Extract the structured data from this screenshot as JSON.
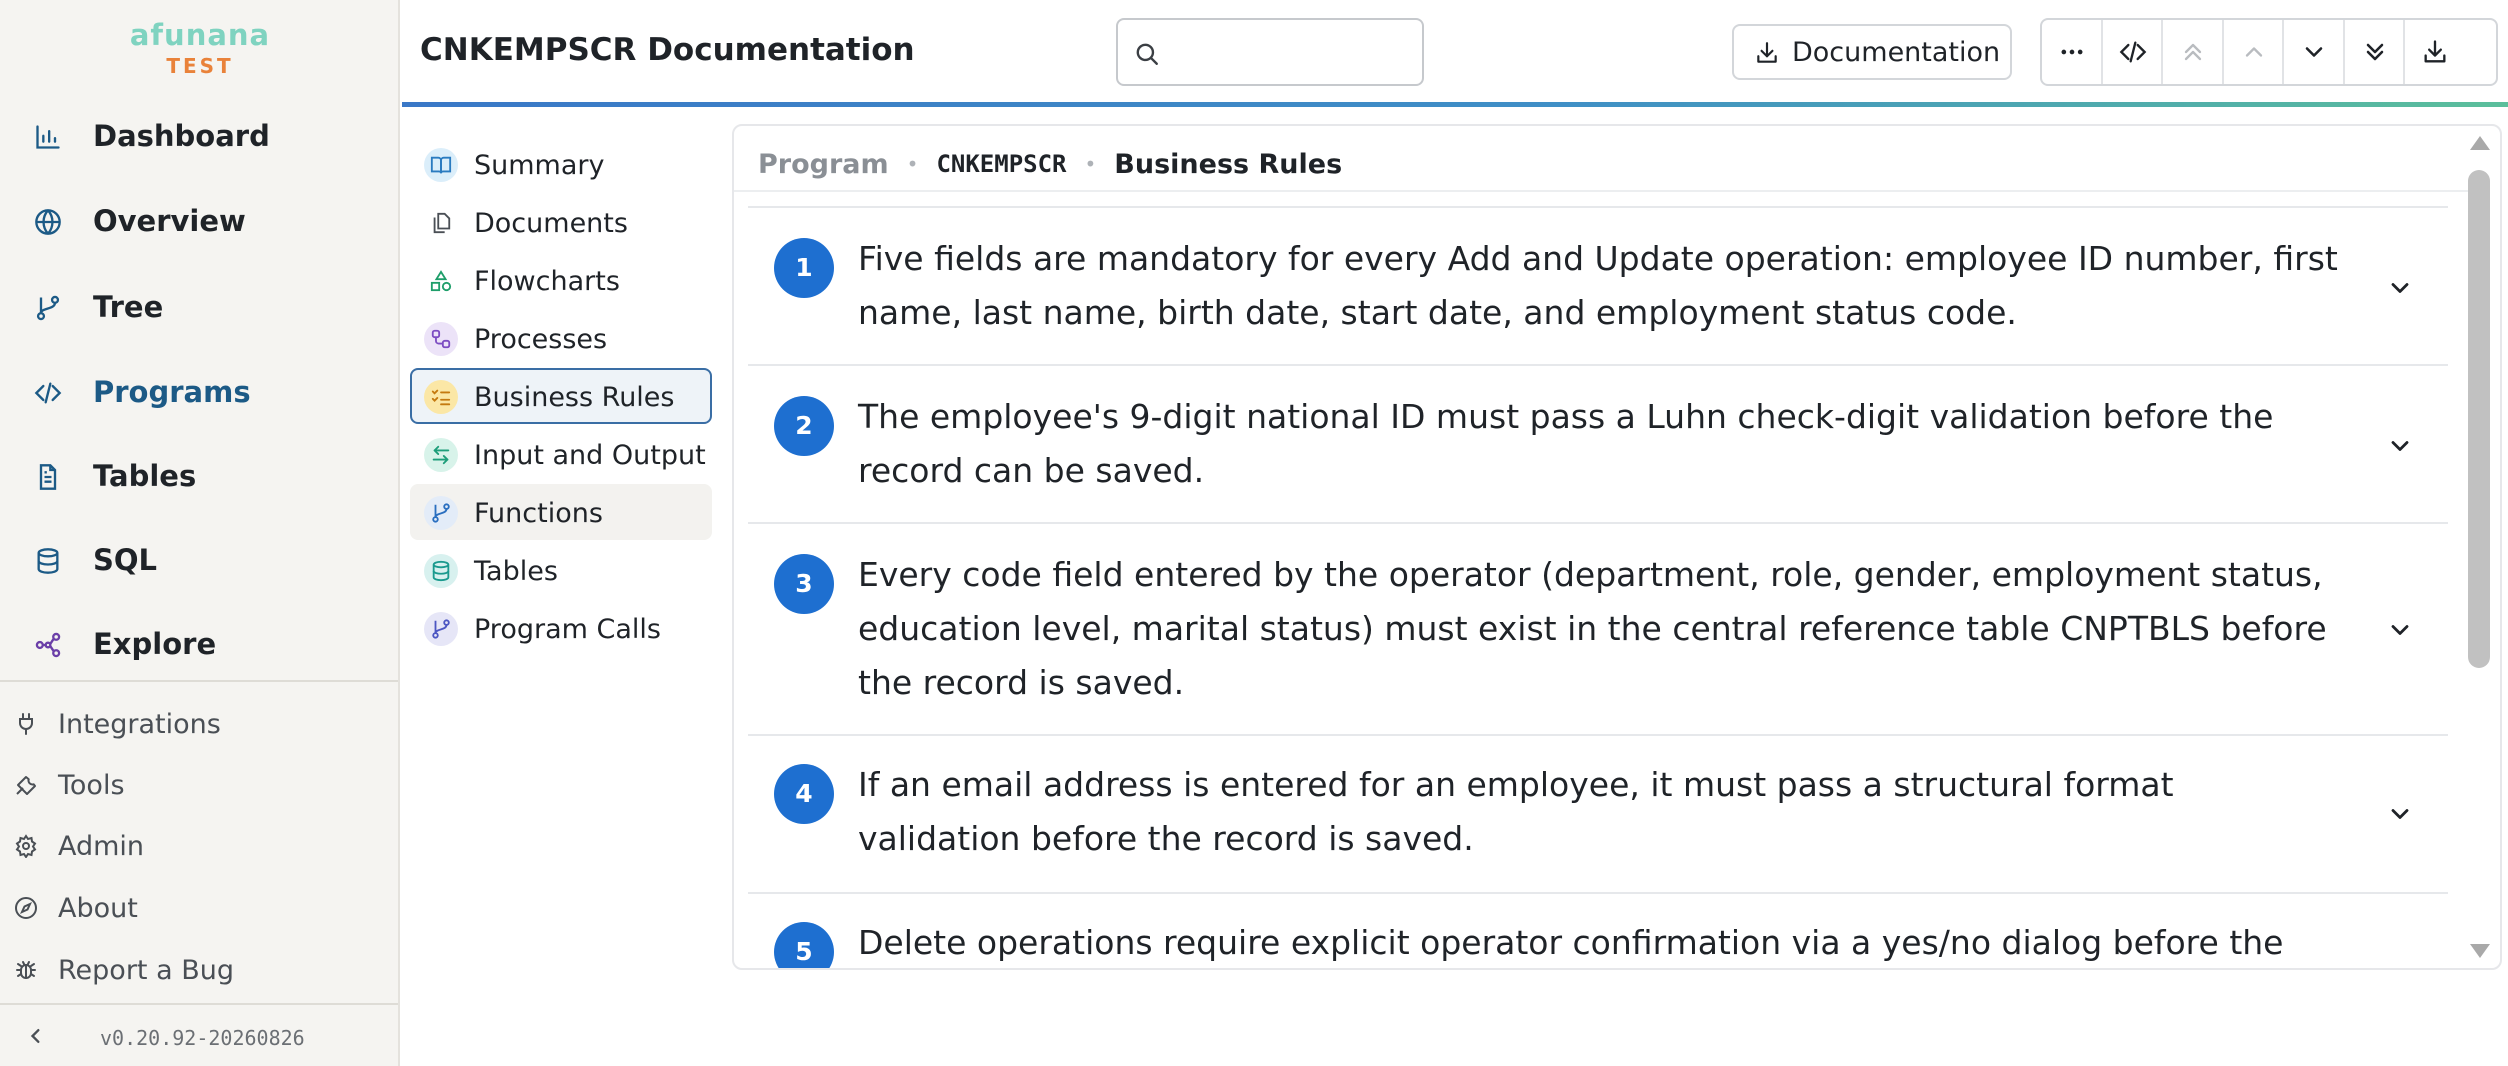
{
  "app": {
    "logo_name": "afunana",
    "logo_env": "TEST",
    "version": "v0.20.92-20260826"
  },
  "sidebar": {
    "items": [
      {
        "label": "Dashboard",
        "icon": "bar-chart-icon"
      },
      {
        "label": "Overview",
        "icon": "globe-icon"
      },
      {
        "label": "Tree",
        "icon": "branch-icon"
      },
      {
        "label": "Programs",
        "icon": "code-icon",
        "active": true
      },
      {
        "label": "Tables",
        "icon": "document-icon"
      },
      {
        "label": "SQL",
        "icon": "database-icon"
      },
      {
        "label": "Explore",
        "icon": "graph-icon"
      }
    ],
    "utilities": [
      {
        "label": "Integrations",
        "icon": "plug-icon"
      },
      {
        "label": "Tools",
        "icon": "wrench-icon"
      },
      {
        "label": "Admin",
        "icon": "gear-icon"
      },
      {
        "label": "About",
        "icon": "compass-icon"
      },
      {
        "label": "Report a Bug",
        "icon": "bug-icon"
      }
    ]
  },
  "header": {
    "title": "CNKEMPSCR Documentation",
    "search_value": "",
    "documentation_button": "Documentation",
    "toolbar": [
      "more-icon",
      "code-icon",
      "double-chevron-up-icon",
      "chevron-up-icon",
      "chevron-down-icon",
      "double-chevron-down-icon",
      "download-icon"
    ]
  },
  "subnav": {
    "items": [
      {
        "label": "Summary",
        "icon": "book-icon"
      },
      {
        "label": "Documents",
        "icon": "documents-icon"
      },
      {
        "label": "Flowcharts",
        "icon": "shapes-icon"
      },
      {
        "label": "Processes",
        "icon": "process-icon"
      },
      {
        "label": "Business Rules",
        "icon": "checklist-icon",
        "active": true
      },
      {
        "label": "Input and Output",
        "icon": "arrows-icon"
      },
      {
        "label": "Functions",
        "icon": "branch-icon"
      },
      {
        "label": "Tables",
        "icon": "database-icon"
      },
      {
        "label": "Program Calls",
        "icon": "branch-icon"
      }
    ]
  },
  "breadcrumb": {
    "root": "Program",
    "program": "CNKEMPSCR",
    "current": "Business Rules"
  },
  "rules": [
    {
      "number": "1",
      "text": "Five fields are mandatory for every Add and Update operation: employee ID number, first name, last name, birth date, start date, and employment status code."
    },
    {
      "number": "2",
      "text": "The employee's 9-digit national ID must pass a Luhn check-digit validation before the record can be saved."
    },
    {
      "number": "3",
      "text": "Every code field entered by the operator (department, role, gender, employment status, education level, marital status) must exist in the central reference table CNPTBLS before the record is saved."
    },
    {
      "number": "4",
      "text": "If an email address is entered for an employee, it must pass a structural format validation before the record is saved."
    },
    {
      "number": "5",
      "text": "Delete operations require explicit operator confirmation via a yes/no dialog before the record is"
    }
  ],
  "colors": {
    "accent": "#1e6fd0",
    "active_nav": "#1c5a86",
    "logo_name": "#7fd3c0",
    "logo_env": "#e9823a"
  }
}
